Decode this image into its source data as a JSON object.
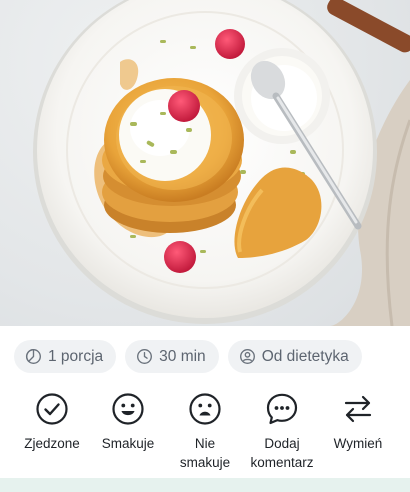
{
  "hero": {
    "image_description_icon": "pancakes-photo"
  },
  "info_chips": [
    {
      "icon": "portion-icon",
      "label": "1 porcja"
    },
    {
      "icon": "clock-icon",
      "label": "30 min"
    },
    {
      "icon": "user-circle-icon",
      "label": "Od dietetyka"
    }
  ],
  "actions": [
    {
      "icon": "check-circle-icon",
      "label": "Zjedzone"
    },
    {
      "icon": "smile-icon",
      "label": "Smakuje"
    },
    {
      "icon": "frown-icon",
      "label": "Nie\nsmakuje"
    },
    {
      "icon": "chat-bubble-icon",
      "label": "Dodaj\nkomentarz"
    },
    {
      "icon": "swap-arrows-icon",
      "label": "Wymień"
    }
  ],
  "colors": {
    "chip_bg": "#f0f2f4",
    "chip_text": "#5d6570",
    "bottom_strip": "#e6f2ee"
  }
}
